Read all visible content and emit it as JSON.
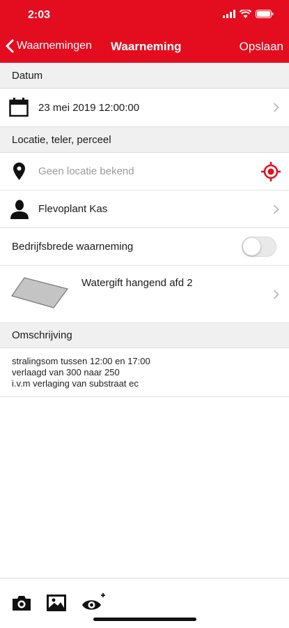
{
  "status_bar": {
    "time": "2:03"
  },
  "nav": {
    "back_label": "Waarnemingen",
    "title": "Waarneming",
    "save_label": "Opslaan"
  },
  "sections": {
    "datum": "Datum",
    "locatie": "Locatie, teler, perceel",
    "omschrijving": "Omschrijving"
  },
  "datum_row": {
    "value": "23 mei 2019 12:00:00"
  },
  "location_row": {
    "placeholder": "Geen locatie bekend"
  },
  "grower_row": {
    "value": "Flevoplant Kas"
  },
  "company_wide_row": {
    "label": "Bedrijfsbrede waarneming",
    "enabled": false
  },
  "plot_row": {
    "label": "Watergift hangend afd 2"
  },
  "description": {
    "lines": [
      "stralingsom tussen 12:00 en 17:00",
      "verlaagd van 300 naar 250",
      "i.v.m verlaging van substraat ec"
    ]
  },
  "toolbar": {
    "icons": [
      "camera-icon",
      "image-icon",
      "eye-plus-icon"
    ]
  },
  "colors": {
    "accent": "#e30d1f",
    "section_bg": "#f0f0f0",
    "placeholder": "#9b9b9b"
  }
}
